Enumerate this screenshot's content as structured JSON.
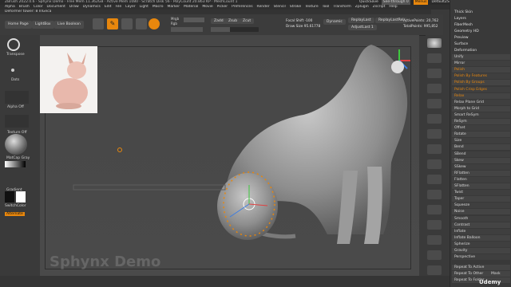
{
  "title": "ZBrush 2022.0.6 · Sphynx Demo · Free Mem 11.362GB · Active Mem 1080 · Scratch Disk 56 · PolyCount 20.863 KP · MeshCount 1",
  "quick": {
    "quicksave": "QuickSave",
    "seethrough": "See-through 0",
    "menus": "Menus",
    "default": "DefaultZScript"
  },
  "menubar": [
    "Alpha",
    "Brush",
    "Color",
    "Document",
    "Draw",
    "Dynamics",
    "Edit",
    "File",
    "Layer",
    "Light",
    "Macro",
    "Marker",
    "Material",
    "Movie",
    "Picker",
    "Preferences",
    "Render",
    "Stencil",
    "Stroke",
    "Texture",
    "Tool",
    "Transform",
    "Zplugin",
    "Zscript",
    "Help"
  ],
  "statusline": "Deformer tower: 8 InGeca",
  "toolbar": {
    "home": "Home Page",
    "lightbox": "LightBox",
    "liveboolean": "Live Boolean",
    "edit": "Edit",
    "draw": "Draw",
    "move": "Move",
    "scale": "Scale",
    "rotate": "Rotate",
    "mrgb": "Mrgb",
    "rgb": "Rgb",
    "m": "M",
    "zadd": "Zadd",
    "zsub": "Zsub",
    "zcut": "Zcut",
    "focal": "Focal Shift -100",
    "drawsize": "Draw Size 95.61778",
    "dynamic": "Dynamic",
    "replaylast": "ReplayLast",
    "replayrel": "ReplayLastRel",
    "adjustlast": "AdjustLast 1",
    "activepoints": "ActivePoints: 20,762",
    "totalpoints": "TotalPoints: 995,852",
    "rgb_int": "Rgb Intensity",
    "z_int": "Z Intensity"
  },
  "lefttray": {
    "transpose": "Transpose",
    "dots": "Dots",
    "alpha": "Alpha Off",
    "texture": "Texture Off",
    "matcap": "MatCap Gray",
    "gradient": "Gradient",
    "switch": "SwitchColor",
    "alternate": "Alternate"
  },
  "canvas": {
    "watermark": "Sphynx Demo"
  },
  "rightpanel": {
    "top": [
      "Thick Skin",
      "Layers",
      "FiberMesh",
      "Geometry HD",
      "Preview",
      "Surface",
      "Deformation"
    ],
    "items": [
      "Unify",
      "Mirror",
      "Polish",
      "Polish By Features",
      "Polish By Groups",
      "Polish Crisp Edges",
      "Relax",
      "Relax Plane Grid",
      "Morph to Grid",
      "Smart ReSym",
      "ReSym",
      "Offset",
      "Rotate",
      "Size",
      "Bend",
      "SBend",
      "Skew",
      "SSkew",
      "RFlatten",
      "Flatten",
      "SFlatten",
      "Twist",
      "Taper",
      "Squeeze",
      "Noise",
      "Smooth",
      "Contrast",
      "Inflate",
      "Inflate Balloon",
      "Spherize",
      "Gravity",
      "Perspective"
    ],
    "bottom": [
      "Repeat To Active",
      "Repeat To Other",
      "Repeat To Folder",
      "Mask"
    ]
  },
  "right_icons": [
    "Spix",
    "Scroll",
    "Zoom",
    "Actual",
    "AAHalf",
    "Persp",
    "Floor",
    "Local",
    "Frame",
    "Move",
    "ZoomD",
    "Rotate",
    "Transp",
    "Ghost",
    "Solo",
    "Xpose"
  ],
  "brand": "Udemy",
  "colors": {
    "accent": "#e8870d",
    "panel": "#393939",
    "canvas": "#4a4a4a"
  }
}
